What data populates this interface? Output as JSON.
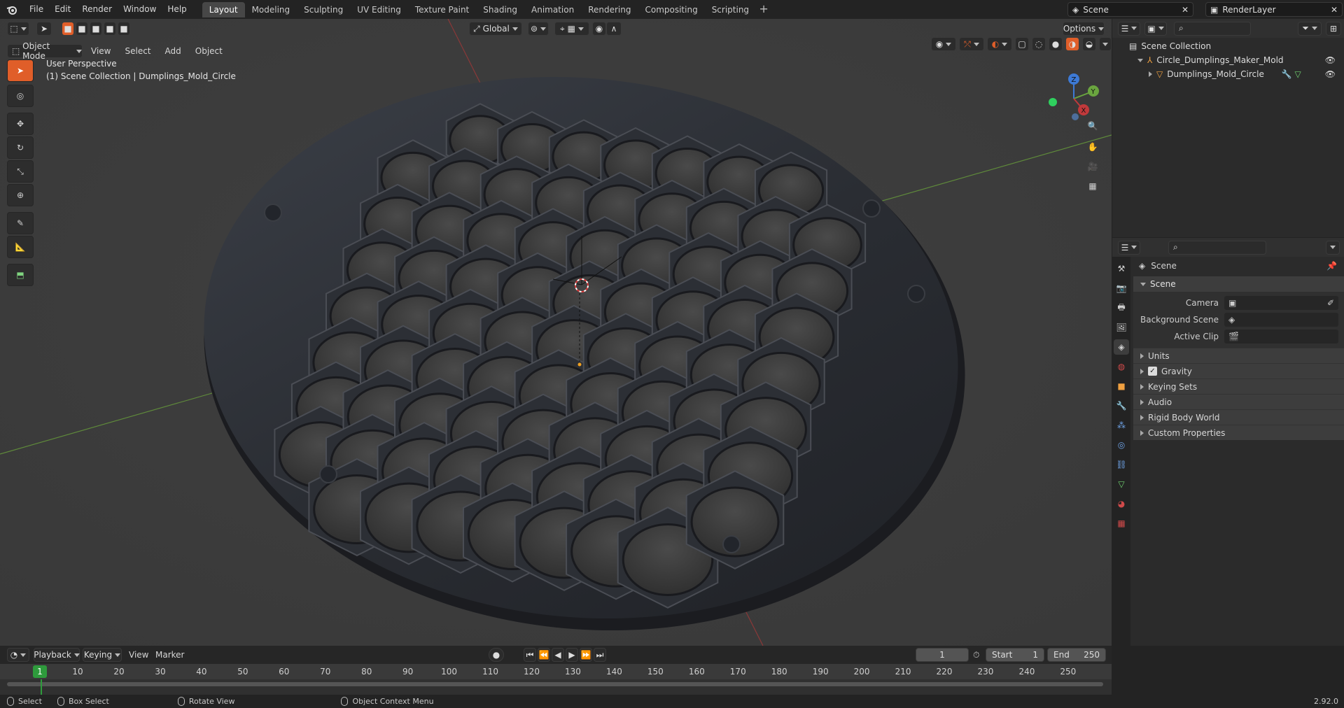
{
  "menu": {
    "file": "File",
    "edit": "Edit",
    "render": "Render",
    "window": "Window",
    "help": "Help"
  },
  "workspaces": [
    {
      "label": "Layout",
      "active": true
    },
    {
      "label": "Modeling"
    },
    {
      "label": "Sculpting"
    },
    {
      "label": "UV Editing"
    },
    {
      "label": "Texture Paint"
    },
    {
      "label": "Shading"
    },
    {
      "label": "Animation"
    },
    {
      "label": "Rendering"
    },
    {
      "label": "Compositing"
    },
    {
      "label": "Scripting"
    }
  ],
  "scene_name": "Scene",
  "view_layer": "RenderLayer",
  "viewport": {
    "mode": "Object Mode",
    "menus": {
      "view": "View",
      "select": "Select",
      "add": "Add",
      "object": "Object"
    },
    "orientation": "Global",
    "options": "Options",
    "overlay_line1": "User Perspective",
    "overlay_line2": "(1) Scene Collection | Dumplings_Mold_Circle",
    "gizmo": {
      "x": "X",
      "y": "Y",
      "z": "Z"
    }
  },
  "outliner": {
    "root": "Scene Collection",
    "items": [
      {
        "label": "Circle_Dumplings_Maker_Mold"
      },
      {
        "label": "Dumplings_Mold_Circle"
      }
    ]
  },
  "properties": {
    "header": "Scene",
    "panel": "Scene",
    "camera_label": "Camera",
    "bg_scene_label": "Background Scene",
    "active_clip_label": "Active Clip",
    "subpanels": {
      "units": "Units",
      "gravity": "Gravity",
      "keying": "Keying Sets",
      "audio": "Audio",
      "rigid": "Rigid Body World",
      "custom": "Custom Properties"
    },
    "gravity_checked": true
  },
  "timeline": {
    "playback": "Playback",
    "keying": "Keying",
    "view": "View",
    "marker": "Marker",
    "current_frame": "1",
    "start_label": "Start",
    "start": "1",
    "end_label": "End",
    "end": "250",
    "ticks": [
      "10",
      "20",
      "30",
      "40",
      "50",
      "60",
      "70",
      "80",
      "90",
      "100",
      "110",
      "120",
      "130",
      "140",
      "150",
      "160",
      "170",
      "180",
      "190",
      "200",
      "210",
      "220",
      "230",
      "240",
      "250"
    ],
    "cursor_frame": "1"
  },
  "status": {
    "select": "Select",
    "box_select": "Box Select",
    "rotate": "Rotate View",
    "context": "Object Context Menu",
    "version": "2.92.0"
  },
  "colors": {
    "accent": "#e05e29",
    "selection": "#5d83c4",
    "x_axis": "#c0393b",
    "y_axis": "#70a843"
  }
}
